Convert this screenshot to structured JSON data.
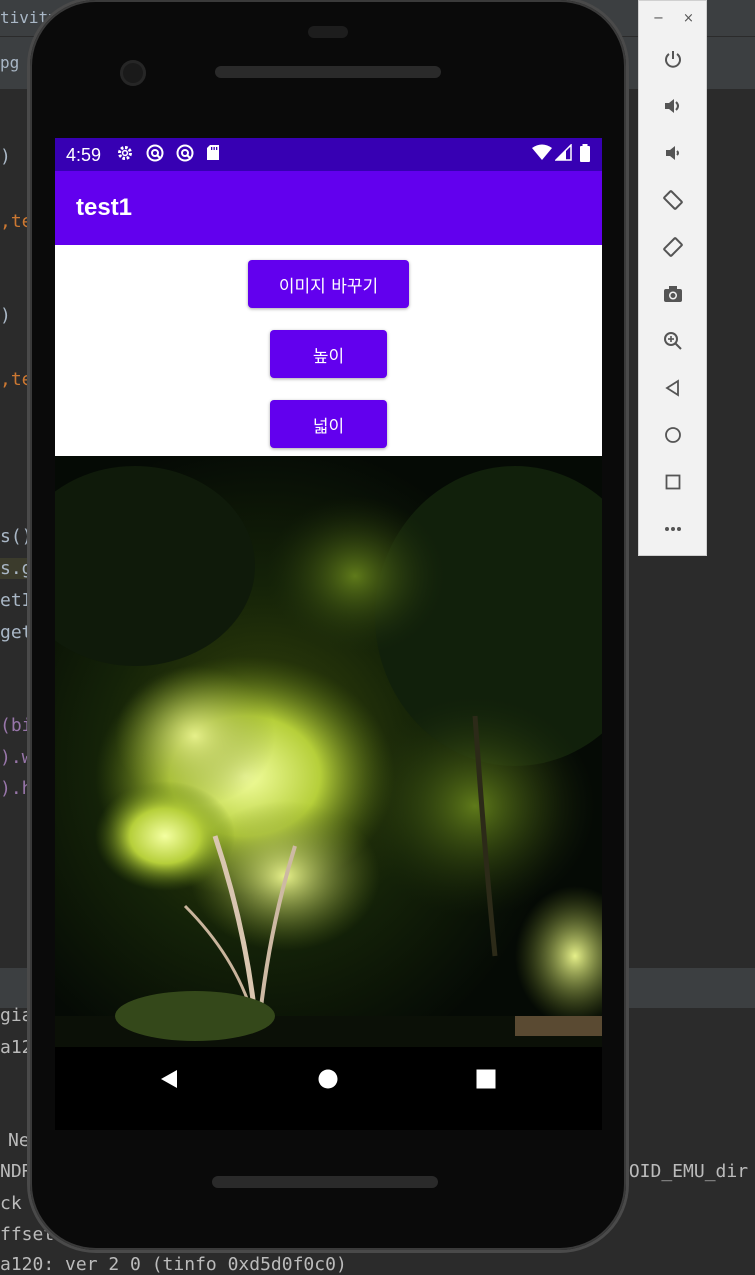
{
  "ide": {
    "title_fragment": "tivity",
    "tab_fragment": "pg",
    "code_lines": [
      ")",
      ",te",
      ")",
      ",te",
      "s()",
      "s.g",
      "etI",
      "get",
      "(bi",
      ").w",
      ").h"
    ],
    "log_lines": [
      "gia",
      "a12",
      "Ne",
      "NDR",
      "ck",
      "ffset",
      "a120: ver 2 0 (tinfo 0xd5d0f0c0)"
    ],
    "log_right": [
      "ROID_EMU_dir"
    ]
  },
  "emulator_toolbar": {
    "minimize": "−",
    "close": "×",
    "buttons": [
      "power-icon",
      "volume-up-icon",
      "volume-down-icon",
      "rotate-left-icon",
      "rotate-right-icon",
      "camera-icon",
      "zoom-icon",
      "back-icon",
      "home-icon",
      "overview-icon",
      "more-icon"
    ]
  },
  "status_bar": {
    "time": "4:59"
  },
  "app_bar": {
    "title": "test1"
  },
  "buttons": {
    "change_image": "이미지 바꾸기",
    "height": "높이",
    "width": "넓이"
  },
  "colors": {
    "status_bar": "#3700b3",
    "primary": "#6200ee"
  }
}
